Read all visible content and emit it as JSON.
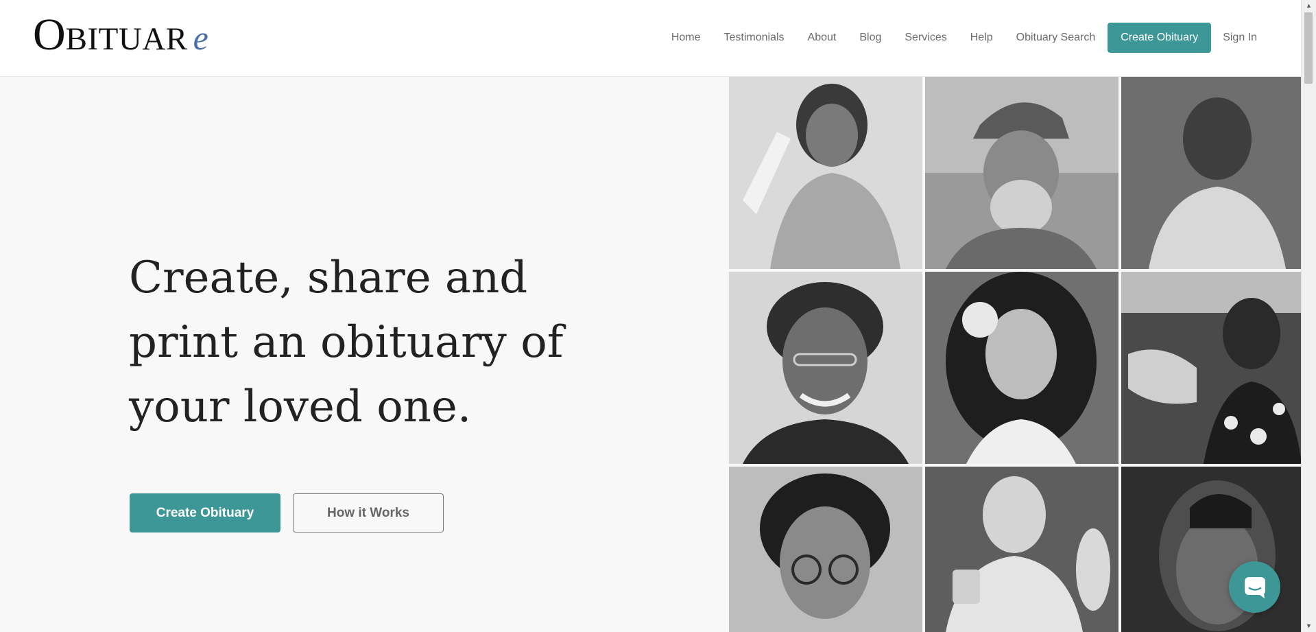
{
  "logo": {
    "first": "O",
    "rest": "BITUAR",
    "suffix": "e"
  },
  "nav": {
    "items": [
      "Home",
      "Testimonials",
      "About",
      "Blog",
      "Services",
      "Help",
      "Obituary Search"
    ],
    "cta": "Create Obituary",
    "sign_in": "Sign In"
  },
  "hero": {
    "title": "Create, share and print an obituary of your loved one.",
    "primary_button": "Create Obituary",
    "secondary_button": "How it Works"
  },
  "colors": {
    "accent": "#3e9797",
    "logo_e": "#4a6fa8",
    "text": "#222222",
    "nav_text": "#6b6b6b",
    "background": "#f8f8f8"
  },
  "icons": {
    "chat": "chat-icon",
    "scroll_up": "scroll-up-icon",
    "scroll_down": "scroll-down-icon"
  }
}
